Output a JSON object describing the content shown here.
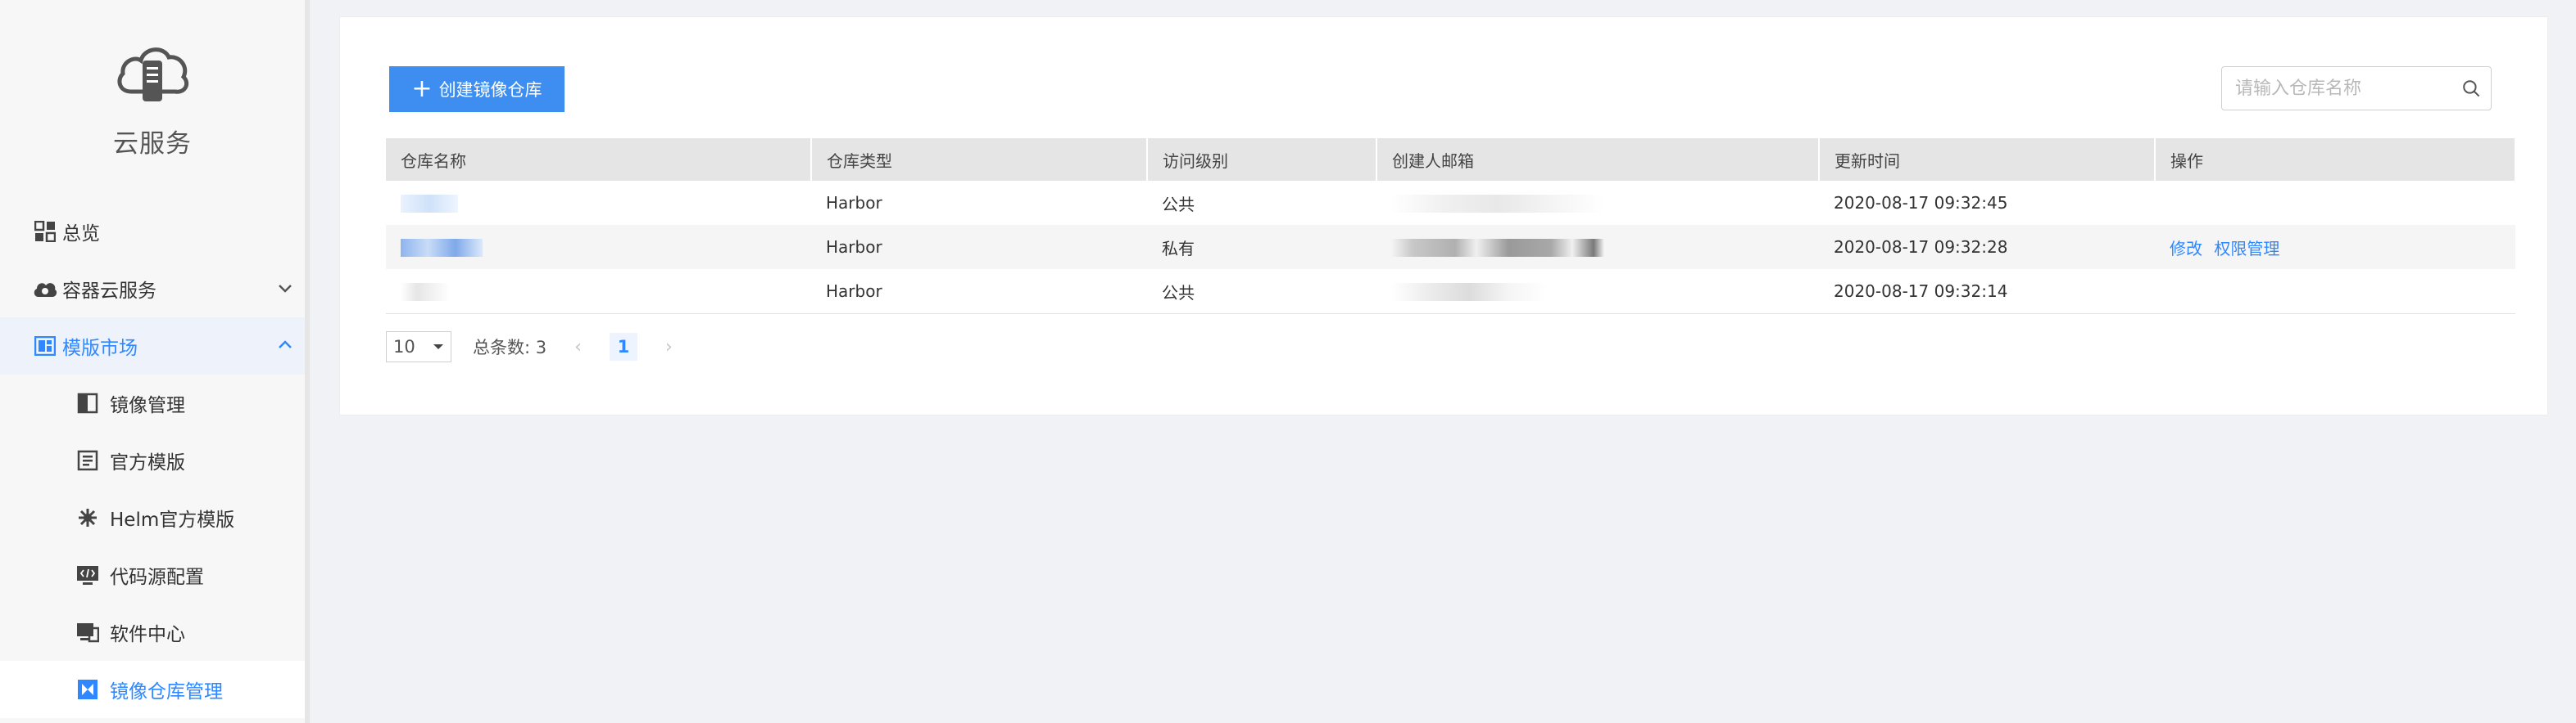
{
  "sidebar": {
    "brand": "云服务",
    "items": [
      {
        "label": "总览"
      },
      {
        "label": "容器云服务"
      },
      {
        "label": "模版市场"
      }
    ],
    "subitems": [
      {
        "label": "镜像管理"
      },
      {
        "label": "官方模版"
      },
      {
        "label": "Helm官方模版"
      },
      {
        "label": "代码源配置"
      },
      {
        "label": "软件中心"
      },
      {
        "label": "镜像仓库管理"
      }
    ]
  },
  "toolbar": {
    "create_label": "创建镜像仓库",
    "search_placeholder": "请输入仓库名称"
  },
  "table": {
    "headers": [
      "仓库名称",
      "仓库类型",
      "访问级别",
      "创建人邮箱",
      "更新时间",
      "操作"
    ],
    "rows": [
      {
        "type": "Harbor",
        "access": "公共",
        "updated": "2020-08-17 09:32:45",
        "op_edit": "",
        "op_perm": ""
      },
      {
        "type": "Harbor",
        "access": "私有",
        "updated": "2020-08-17 09:32:28",
        "op_edit": "修改",
        "op_perm": "权限管理"
      },
      {
        "type": "Harbor",
        "access": "公共",
        "updated": "2020-08-17 09:32:14",
        "op_edit": "",
        "op_perm": ""
      }
    ]
  },
  "pager": {
    "page_size": "10",
    "total_label": "总条数: 3",
    "current_page": "1"
  },
  "colors": {
    "accent": "#2f88ff",
    "button": "#3d8ef0",
    "header_bg": "#e5e5e5"
  }
}
